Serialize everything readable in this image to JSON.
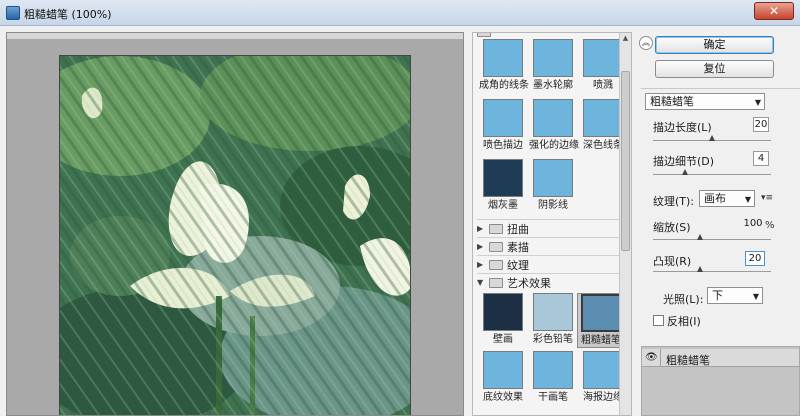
{
  "window": {
    "title": "粗糙蜡笔 (100%)",
    "close_label": "✕"
  },
  "gallery": {
    "top_row": [
      {
        "label": "成角的线条"
      },
      {
        "label": "墨水轮廓"
      },
      {
        "label": "喷溅"
      }
    ],
    "row2": [
      {
        "label": "喷色描边"
      },
      {
        "label": "强化的边缘"
      },
      {
        "label": "深色线条"
      }
    ],
    "row3": [
      {
        "label": "烟灰墨"
      },
      {
        "label": "阴影线"
      }
    ],
    "categories": [
      {
        "label": "扭曲",
        "expanded": false
      },
      {
        "label": "素描",
        "expanded": false
      },
      {
        "label": "纹理",
        "expanded": false
      },
      {
        "label": "艺术效果",
        "expanded": true
      }
    ],
    "art_row1": [
      {
        "label": "壁画"
      },
      {
        "label": "彩色铅笔"
      },
      {
        "label": "粗糙蜡笔",
        "selected": true
      }
    ],
    "art_row2": [
      {
        "label": "底纹效果"
      },
      {
        "label": "干画笔"
      },
      {
        "label": "海报边缘"
      }
    ]
  },
  "buttons": {
    "ok": "确定",
    "reset": "复位"
  },
  "settings": {
    "filter_select": "粗糙蜡笔",
    "stroke_length": {
      "label": "描边长度(L)",
      "value": "20",
      "level": 0.5
    },
    "stroke_detail": {
      "label": "描边细节(D)",
      "value": "4",
      "level": 0.27
    },
    "texture": {
      "label": "纹理(T):",
      "value": "画布",
      "menu_icon": "▾≡"
    },
    "scaling": {
      "label": "缩放(S)",
      "value": "100",
      "unit": "%",
      "level": 0.4
    },
    "relief": {
      "label": "凸现(R)",
      "value": "20",
      "level": 0.4
    },
    "light": {
      "label": "光照(L):",
      "value": "下"
    },
    "invert": {
      "label": "反相(I)",
      "checked": false
    }
  },
  "layers": {
    "row_label": "粗糙蜡笔"
  }
}
